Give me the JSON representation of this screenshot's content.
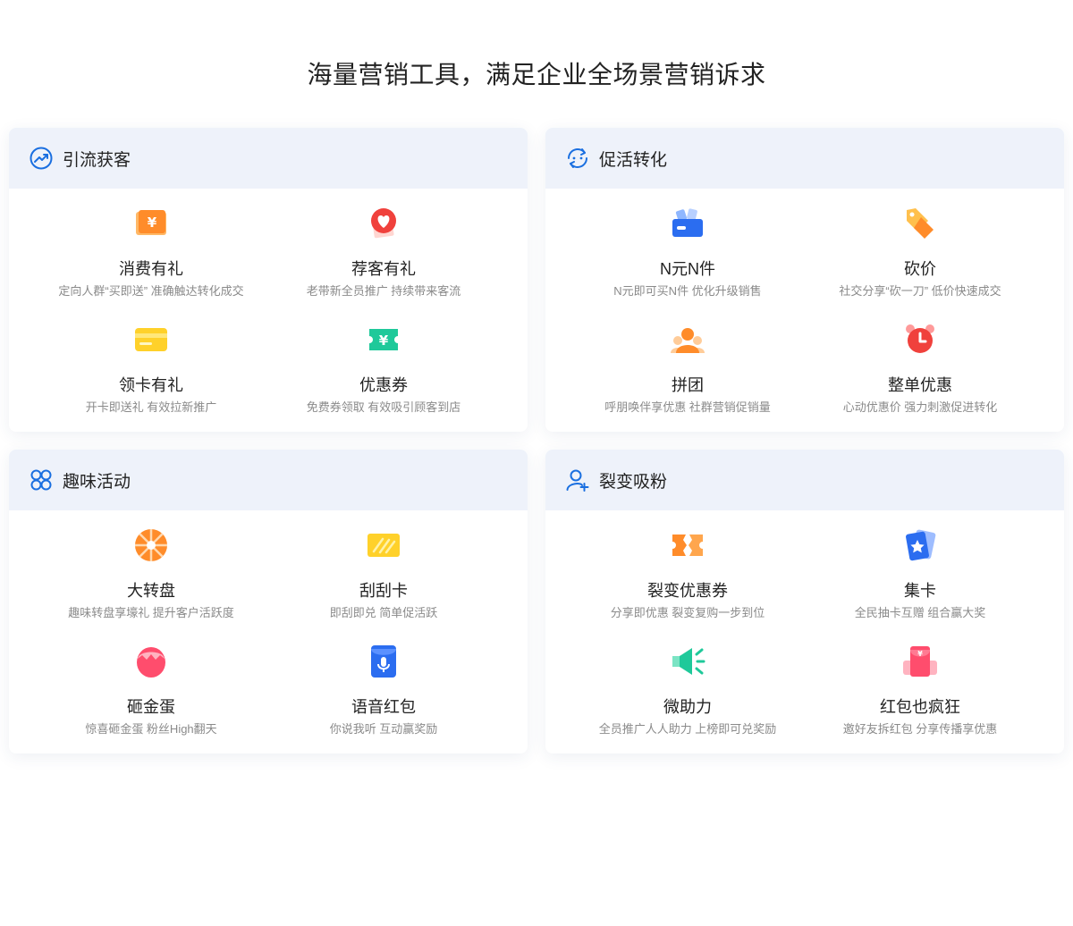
{
  "page": {
    "title": "海量营销工具，满足企业全场景营销诉求"
  },
  "colors": {
    "accent": "#1a6fe0",
    "header_bg": "#eef2fa",
    "desc": "#8a8a8a"
  },
  "cards": [
    {
      "title": "引流获客",
      "icon": "trend-up-icon",
      "tools": [
        {
          "name": "消费有礼",
          "desc": "定向人群“买即送” 准确触达转化成交",
          "icon": "yuan-ticket-icon"
        },
        {
          "name": "荐客有礼",
          "desc": "老带新全员推广 持续带来客流",
          "icon": "heart-icon"
        },
        {
          "name": "领卡有礼",
          "desc": "开卡即送礼 有效拉新推广",
          "icon": "card-icon"
        },
        {
          "name": "优惠券",
          "desc": "免费券领取 有效吸引顾客到店",
          "icon": "coupon-icon"
        }
      ]
    },
    {
      "title": "促活转化",
      "icon": "cycle-icon",
      "tools": [
        {
          "name": "N元N件",
          "desc": "N元即可买N件 优化升级销售",
          "icon": "basket-icon"
        },
        {
          "name": "砍价",
          "desc": "社交分享“砍一刀” 低价快速成交",
          "icon": "price-tag-icon"
        },
        {
          "name": "拼团",
          "desc": "呼朋唤伴享优惠 社群营销促销量",
          "icon": "group-icon"
        },
        {
          "name": "整单优惠",
          "desc": "心动优惠价 强力刺激促进转化",
          "icon": "alarm-clock-icon"
        }
      ]
    },
    {
      "title": "趣味活动",
      "icon": "four-petal-icon",
      "tools": [
        {
          "name": "大转盘",
          "desc": "趣味转盘享壕礼 提升客户活跃度",
          "icon": "wheel-icon"
        },
        {
          "name": "刮刮卡",
          "desc": "即刮即兑 简单促活跃",
          "icon": "scratch-card-icon"
        },
        {
          "name": "砸金蛋",
          "desc": "惊喜砸金蛋 粉丝High翻天",
          "icon": "golden-egg-icon"
        },
        {
          "name": "语音红包",
          "desc": "你说我听 互动赢奖励",
          "icon": "microphone-icon"
        }
      ]
    },
    {
      "title": "裂变吸粉",
      "icon": "add-user-icon",
      "tools": [
        {
          "name": "裂变优惠券",
          "desc": "分享即优惠 裂变复购一步到位",
          "icon": "split-coupon-icon"
        },
        {
          "name": "集卡",
          "desc": "全民抽卡互赠 组合赢大奖",
          "icon": "star-card-icon"
        },
        {
          "name": "微助力",
          "desc": "全员推广人人助力 上榜即可兑奖励",
          "icon": "megaphone-icon"
        },
        {
          "name": "红包也疯狂",
          "desc": "邀好友拆红包 分享传播享优惠",
          "icon": "red-packet-icon"
        }
      ]
    }
  ]
}
